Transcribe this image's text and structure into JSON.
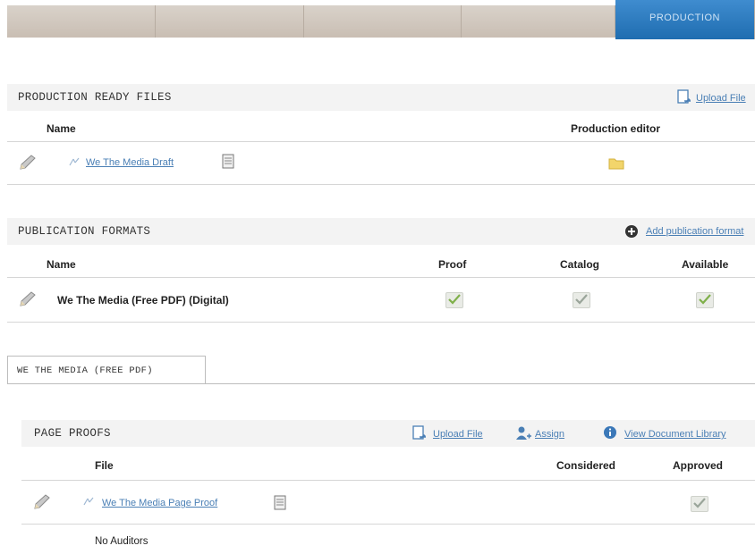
{
  "tabs": [
    {
      "label": ""
    },
    {
      "label": ""
    },
    {
      "label": ""
    },
    {
      "label": ""
    },
    {
      "label": "PRODUCTION"
    }
  ],
  "production_ready_files": {
    "title": "PRODUCTION READY FILES",
    "upload_label": "Upload File",
    "columns": {
      "name": "Name",
      "editor": "Production editor"
    },
    "row": {
      "file_name": "We The Media Draft"
    }
  },
  "publication_formats": {
    "title": "PUBLICATION FORMATS",
    "add_label": "Add publication format",
    "columns": {
      "name": "Name",
      "proof": "Proof",
      "catalog": "Catalog",
      "available": "Available"
    },
    "row": {
      "name": "We The Media (Free PDF) (Digital)"
    }
  },
  "format_tab": {
    "label": "WE THE MEDIA (FREE PDF)"
  },
  "page_proofs": {
    "title": "PAGE PROOFS",
    "upload_label": "Upload File",
    "assign_label": "Assign",
    "library_label": "View Document Library",
    "columns": {
      "file": "File",
      "considered": "Considered",
      "approved": "Approved"
    },
    "row": {
      "file_name": "We The Media Page Proof"
    },
    "auditors_text": "No Auditors"
  },
  "colors": {
    "accent": "#1f6db0",
    "link": "#4a7fb5",
    "section_bg": "#f3f3f3"
  }
}
